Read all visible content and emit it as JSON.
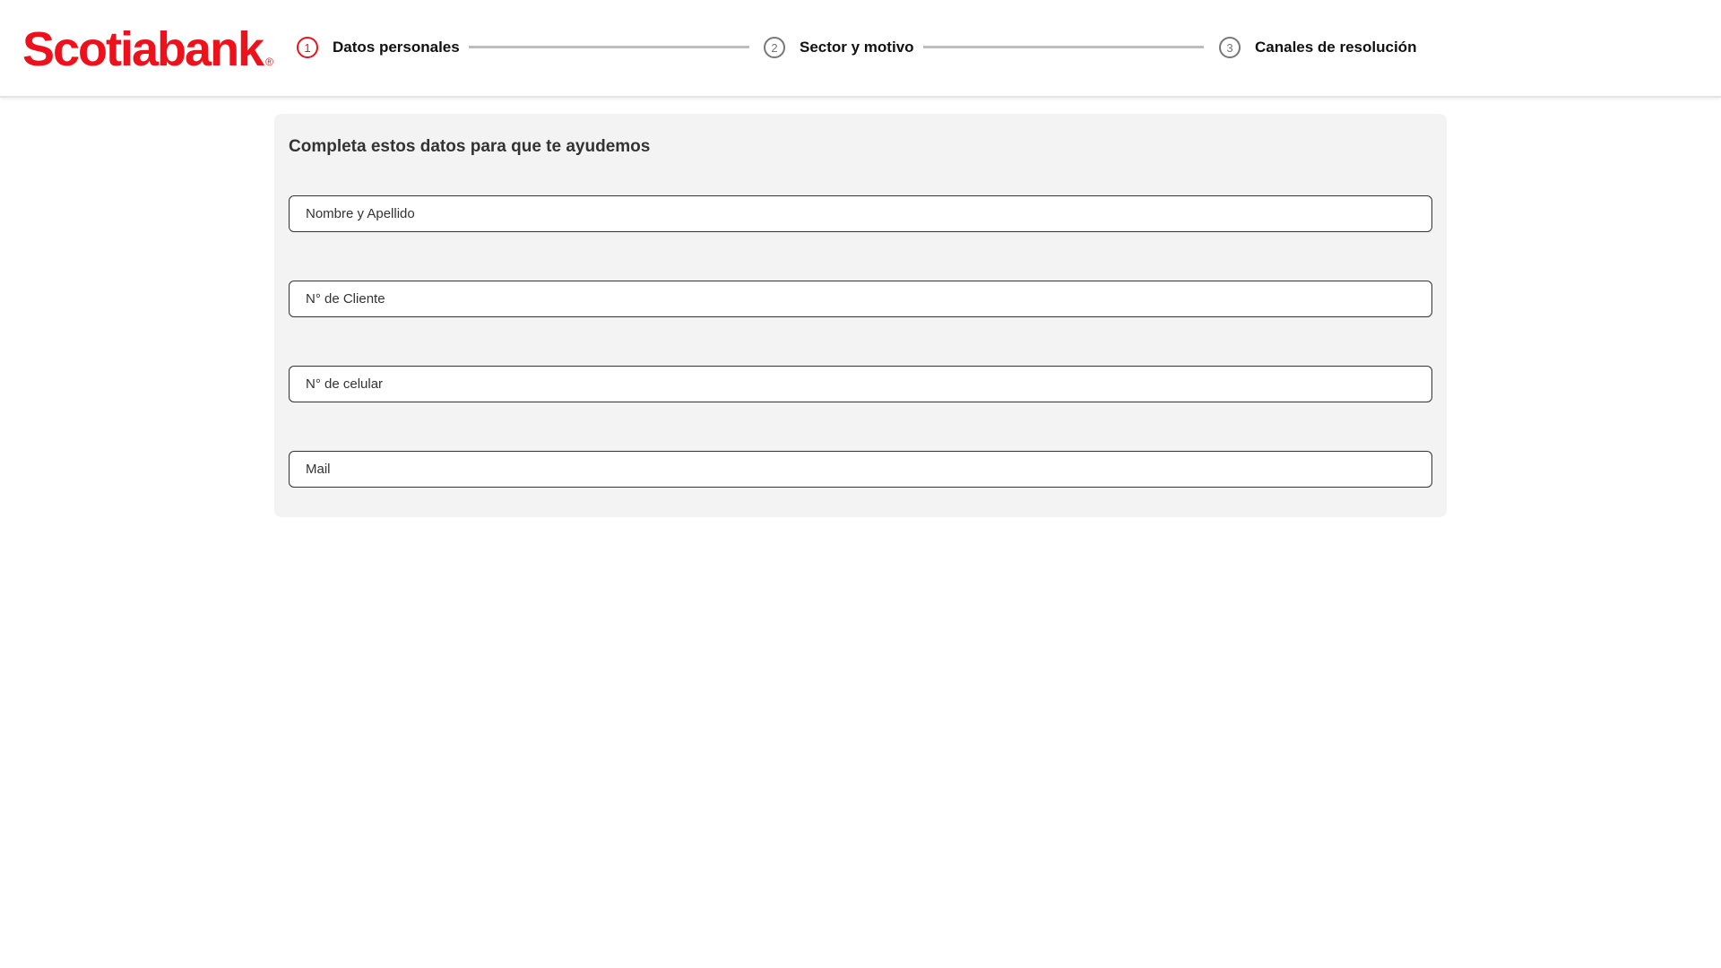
{
  "brand": {
    "name": "Scotiabank",
    "registered": "®",
    "color": "#ec111a"
  },
  "stepper": {
    "steps": [
      {
        "number": "1",
        "label": "Datos personales",
        "active": true
      },
      {
        "number": "2",
        "label": "Sector y motivo",
        "active": false
      },
      {
        "number": "3",
        "label": "Canales de resolución",
        "active": false
      }
    ]
  },
  "form": {
    "title": "Completa estos datos para que te ayudemos",
    "fields": [
      {
        "placeholder": "Nombre y Apellido",
        "value": ""
      },
      {
        "placeholder": "N° de Cliente",
        "value": ""
      },
      {
        "placeholder": "N° de celular",
        "value": ""
      },
      {
        "placeholder": "Mail",
        "value": ""
      }
    ]
  }
}
